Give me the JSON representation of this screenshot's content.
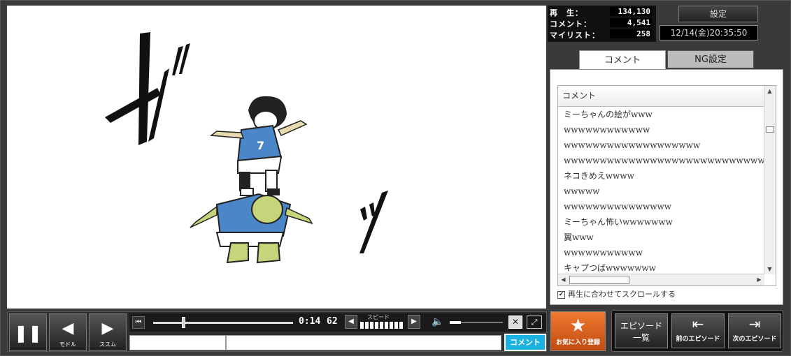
{
  "stats": {
    "views_label": "再　生：",
    "views_value": "134,130",
    "comments_label": "コメント：",
    "comments_value": "4,541",
    "mylist_label": "マイリスト：",
    "mylist_value": "258"
  },
  "settings_button": "設定",
  "clock": "12/14(金)20:35:50",
  "tabs": {
    "comment": "コメント",
    "ng": "NG設定"
  },
  "comment_list": {
    "header": "コメント",
    "rows": [
      "ミーちゃんの絵がwww",
      "wwwwwwwwwwww",
      "wwwwwwwwwwwwwwwwwww",
      "wwwwwwwwwwwwwwwwwwwwwwwwwwwwww",
      "ネコきめえwwww",
      "wwwww",
      "wwwwwwwwwwwwwww",
      "ミーちゃん怖いwwwwwww",
      "翼www",
      "wwwwwwwwwww",
      "キャプつばwwwwwww"
    ]
  },
  "autoscroll_label": "再生に合わせてスクロールする",
  "video_text": {
    "sfx_ga": "ガ",
    "sfx_tsu": "ッ",
    "jersey_number": "7"
  },
  "player": {
    "back_label": "モドル",
    "forward_label": "ススム",
    "time_current": "0:14",
    "time_total": "62",
    "speed_label": "スピード",
    "comment_button": "コメント"
  },
  "buttons": {
    "favorite": "お気に入り登録",
    "episode_list_line1": "エピソード",
    "episode_list_line2": "一覧",
    "prev_episode": "前のエピソード",
    "next_episode": "次のエピソード"
  }
}
